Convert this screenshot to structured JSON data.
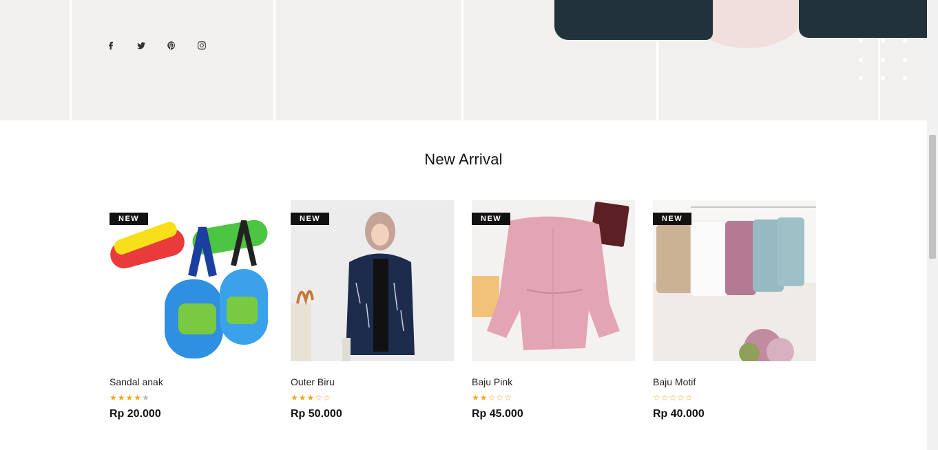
{
  "social": {
    "icons": [
      "facebook-icon",
      "twitter-icon",
      "pinterest-icon",
      "instagram-icon"
    ]
  },
  "section": {
    "title": "New Arrival"
  },
  "products": [
    {
      "name": "Sandal anak",
      "badge": "NEW",
      "rating": 4.5,
      "price": "Rp 20.000"
    },
    {
      "name": "Outer Biru",
      "badge": "NEW",
      "rating": 3,
      "price": "Rp 50.000"
    },
    {
      "name": "Baju Pink",
      "badge": "NEW",
      "rating": 2,
      "price": "Rp 45.000"
    },
    {
      "name": "Baju Motif",
      "badge": "NEW",
      "rating": 0,
      "price": "Rp 40.000"
    }
  ],
  "colors": {
    "hero_bg": "#f1f0ee",
    "badge_bg": "#111111",
    "star": "#f5a623"
  }
}
